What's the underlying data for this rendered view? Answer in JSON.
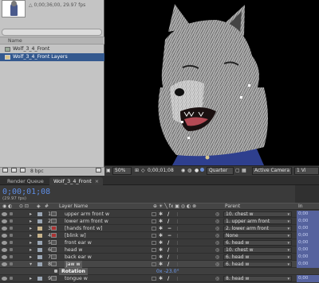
{
  "project": {
    "info_line1": "△ 0;00;36;00, 29.97 fps",
    "name_header": "Name",
    "items": [
      {
        "label": "Wolf_3_4_Front",
        "type": "comp"
      },
      {
        "label": "Wolf_3_4_Front Layers",
        "type": "folder"
      }
    ],
    "bpc_label": "8 bpc"
  },
  "viewer": {
    "zoom": "50%",
    "timecode": "0;00;01;08",
    "resolution": "Quarter",
    "camera": "Active Camera",
    "view_count": "1 Vi"
  },
  "tabs": [
    {
      "label": "Render Queue",
      "active": false
    },
    {
      "label": "Wolf_3_4_Front",
      "active": true
    }
  ],
  "timeline": {
    "timecode": "0;00;01;08",
    "fps": "(29.97 fps)",
    "headers": {
      "number": "#",
      "layer_name": "Layer Name",
      "parent": "Parent",
      "in": "In"
    },
    "layers": [
      {
        "num": "1",
        "name": "upper arm front w",
        "parent": "10. chest w",
        "in": "0;00",
        "color": "#9aa6b4"
      },
      {
        "num": "2",
        "name": "lower arm front w",
        "parent": "1. upper arm front",
        "in": "0;00",
        "color": "#9aa6b4"
      },
      {
        "num": "3",
        "name": "[hands front w]",
        "parent": "2. lower arm front",
        "in": "0;00",
        "color": "#c8b48c"
      },
      {
        "num": "4",
        "name": "[blink w]",
        "parent": "None",
        "in": "0;00",
        "color": "#c8b48c"
      },
      {
        "num": "5",
        "name": "front ear w",
        "parent": "6. head w",
        "in": "0;00",
        "color": "#9aa6b4"
      },
      {
        "num": "6",
        "name": "head w",
        "parent": "10. chest w",
        "in": "0;00",
        "color": "#9aa6b4"
      },
      {
        "num": "7",
        "name": "back ear w",
        "parent": "6. head w",
        "in": "0;00",
        "color": "#9aa6b4"
      },
      {
        "num": "8",
        "name": "jaw w",
        "parent": "6. head w",
        "in": "0;00",
        "color": "#9aa6b4"
      }
    ],
    "rotation": {
      "label": "Rotation",
      "value": "0x -23.0°"
    },
    "last_layer": {
      "num": "9",
      "name": "tongue w",
      "parent": "8. head w",
      "in": "0;00",
      "color": "#9aa6b4"
    }
  },
  "colors": {
    "accent_blue": "#5f8ee6",
    "selection": "#34598f"
  }
}
